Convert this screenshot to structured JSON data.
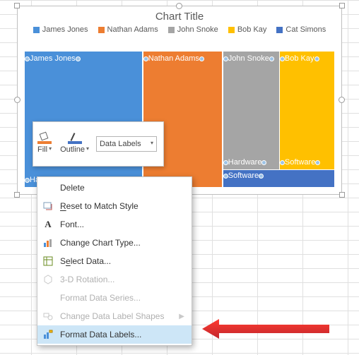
{
  "chart": {
    "title": "Chart Title",
    "legend": [
      {
        "label": "James Jones",
        "color": "#4a90d9"
      },
      {
        "label": "Nathan Adams",
        "color": "#ed7d31"
      },
      {
        "label": "John Snoke",
        "color": "#a5a5a5"
      },
      {
        "label": "Bob Kay",
        "color": "#ffc000"
      },
      {
        "label": "Cat Simons",
        "color": "#4472c4"
      }
    ],
    "cells": {
      "james_jones": "James Jones",
      "nathan_adams": "Nathan Adams",
      "john_snoke": "John Snoke",
      "bob_kay": "Bob Kay",
      "hardware_left": "Hard",
      "hardware_mid": "Hardware",
      "software_r": "Software",
      "software_b": "Software"
    }
  },
  "mini_toolbar": {
    "fill": "Fill",
    "outline": "Outline",
    "combo": "Data Labels"
  },
  "context_menu": {
    "delete": "Delete",
    "reset": "Reset to Match Style",
    "font": "Font...",
    "change_type": "Change Chart Type...",
    "select_data": "Select Data...",
    "rotation": "3-D Rotation...",
    "format_series": "Format Data Series...",
    "change_shapes": "Change Data Label Shapes",
    "format_labels": "Format Data Labels..."
  },
  "chart_data": {
    "type": "treemap",
    "title": "Chart Title",
    "series": [
      {
        "name": "James Jones",
        "color": "#4a90d9",
        "children": [
          {
            "name": "Hardware",
            "value": 38
          }
        ]
      },
      {
        "name": "Nathan Adams",
        "color": "#ed7d31",
        "children": [
          {
            "name": "Hardware",
            "value": 26
          }
        ]
      },
      {
        "name": "John Snoke",
        "color": "#a5a5a5",
        "children": [
          {
            "name": "Hardware",
            "value": 16
          }
        ]
      },
      {
        "name": "Bob Kay",
        "color": "#ffc000",
        "children": [
          {
            "name": "Software",
            "value": 10
          }
        ]
      },
      {
        "name": "Cat Simons",
        "color": "#4472c4",
        "children": [
          {
            "name": "Software",
            "value": 10
          }
        ]
      }
    ],
    "legend_position": "top"
  }
}
